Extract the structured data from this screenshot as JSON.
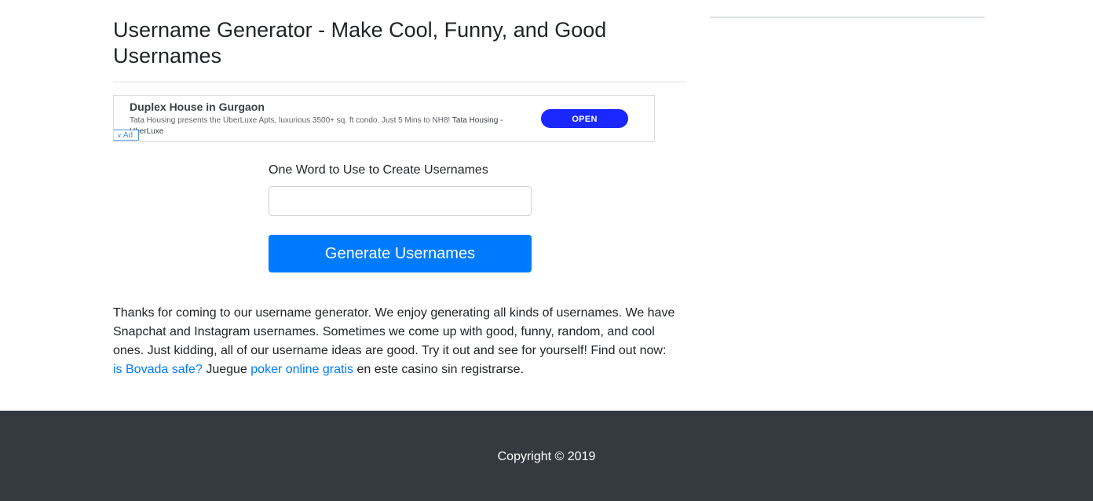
{
  "page": {
    "title": "Username Generator - Make Cool, Funny, and Good Usernames"
  },
  "ad": {
    "title": "Duplex House in Gurgaon",
    "description": "Tata Housing presents the UberLuxe Apts, luxurious 3500+ sq. ft condo. Just 5 Mins to NH8!",
    "advertiser": "Tata Housing - UberLuxe",
    "open_label": "OPEN",
    "badge_label": "Ad",
    "accent_color": "#1a28ff"
  },
  "form": {
    "label": "One Word to Use to Create Usernames",
    "input_value": "",
    "button_label": "Generate Usernames",
    "button_color": "#007bff"
  },
  "intro": {
    "text": "Thanks for coming to our username generator. We enjoy generating all kinds of usernames. We have Snapchat and Instagram usernames. Sometimes we come up with good, funny, random, and cool ones. Just kidding, all of our username ideas are good. Try it out and see for yourself! Find out now:",
    "link1": "is Bovada safe?",
    "middle": "Juegue",
    "link2": "poker online gratis",
    "tail": "en este casino sin registrarse."
  },
  "footer": {
    "copyright": "Copyright © 2019",
    "bg_color": "#343a40"
  }
}
